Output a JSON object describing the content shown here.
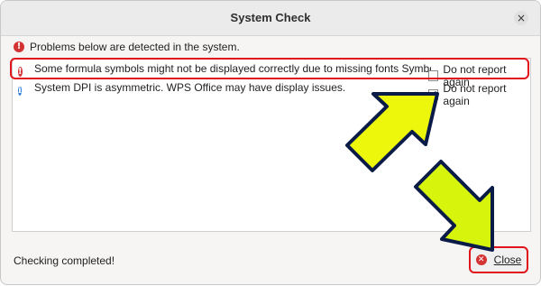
{
  "window": {
    "title": "System Check",
    "close_glyph": "×"
  },
  "header": {
    "message": "Problems below are detected in the system."
  },
  "problems": [
    {
      "icon": "error-icon",
      "text": "Some formula symbols might not be displayed correctly due to missing fonts Symbol, Wing…",
      "checkbox_label": "Do not report again",
      "checked": false
    },
    {
      "icon": "info-icon",
      "text": "System DPI is asymmetric. WPS Office may have display issues.",
      "checkbox_label": "Do not report again",
      "checked": true
    }
  ],
  "footer": {
    "status": "Checking completed!",
    "close_label": "Close"
  },
  "colors": {
    "highlight": "#e0141a",
    "arrow_fill": "#ecf70c",
    "arrow_stroke": "#0b1b47",
    "error": "#d43333",
    "info": "#2f7fd8"
  }
}
